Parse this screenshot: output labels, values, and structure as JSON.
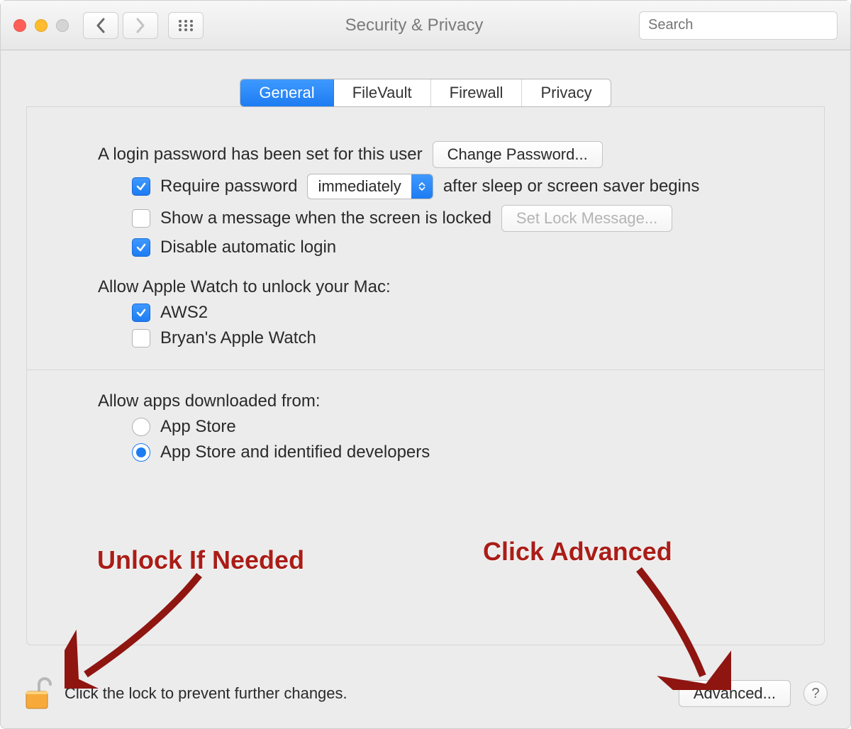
{
  "window": {
    "title": "Security & Privacy",
    "search_placeholder": "Search"
  },
  "tabs": {
    "general": "General",
    "filevault": "FileVault",
    "firewall": "Firewall",
    "privacy": "Privacy"
  },
  "general": {
    "login_password_set": "A login password has been set for this user",
    "change_password_btn": "Change Password...",
    "require_password_label": "Require password",
    "require_password_value": "immediately",
    "after_sleep_text": "after sleep or screen saver begins",
    "show_message_label": "Show a message when the screen is locked",
    "set_lock_message_btn": "Set Lock Message...",
    "disable_auto_login": "Disable automatic login",
    "apple_watch_heading": "Allow Apple Watch to unlock your Mac:",
    "watch1": "AWS2",
    "watch2": "Bryan's Apple Watch",
    "allow_apps_heading": "Allow apps downloaded from:",
    "app_store": "App Store",
    "app_store_dev": "App Store and identified developers"
  },
  "footer": {
    "lock_text": "Click the lock to prevent further changes.",
    "advanced_btn": "Advanced...",
    "help_label": "?"
  },
  "annotations": {
    "unlock": "Unlock If Needed",
    "advanced": "Click Advanced"
  }
}
